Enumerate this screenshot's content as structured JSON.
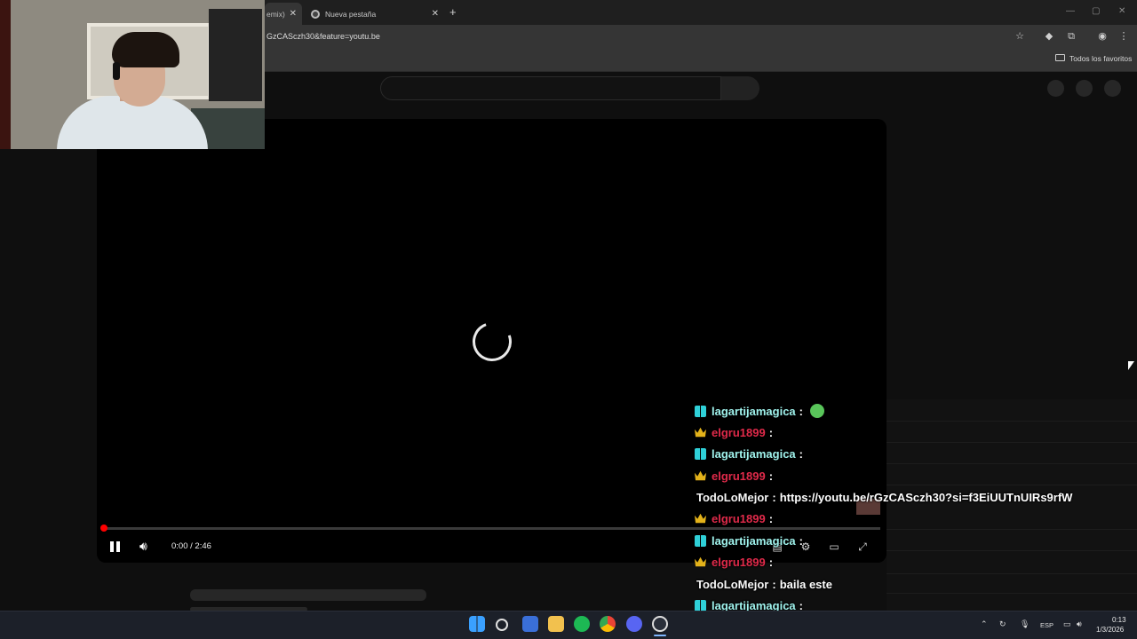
{
  "browser": {
    "active_tab_fragment": "emix)",
    "new_tab_label": "Nueva pestaña",
    "url_fragment": "GzCASczh30&feature=youtu.be",
    "bookmarks_folder_label": "Todos los favoritos",
    "icons": [
      "close-icon",
      "chrome-icon",
      "plus-icon",
      "star-icon",
      "extension-icon",
      "profile-icon",
      "kebab-menu-icon",
      "folder-icon"
    ]
  },
  "player": {
    "time": "0:00 / 2:46",
    "progress": 0.0,
    "state": "loading",
    "controls": [
      "pause-icon",
      "volume-icon",
      "subtitles-icon",
      "settings-icon",
      "theater-mode-icon",
      "fullscreen-icon"
    ]
  },
  "chat": {
    "messages": [
      {
        "user": "lagartijamagica",
        "badge": "mod",
        "color": "cyan",
        "text": ""
      },
      {
        "user": "elgru1899",
        "badge": "crown",
        "color": "red",
        "text": ""
      },
      {
        "user": "lagartijamagica",
        "badge": "mod",
        "color": "cyan",
        "text": ""
      },
      {
        "user": "elgru1899",
        "badge": "crown",
        "color": "red",
        "text": ""
      },
      {
        "user": "TodoLoMejor",
        "badge": "",
        "color": "white",
        "text": "https://youtu.be/rGzCASczh30?si=f3EiUUTnUIRs9rfW"
      },
      {
        "user": "elgru1899",
        "badge": "crown",
        "color": "red",
        "text": ""
      },
      {
        "user": "lagartijamagica",
        "badge": "mod",
        "color": "cyan",
        "text": ""
      },
      {
        "user": "elgru1899",
        "badge": "crown",
        "color": "red",
        "text": ""
      },
      {
        "user": "TodoLoMejor",
        "badge": "",
        "color": "white",
        "text": "baila este"
      },
      {
        "user": "lagartijamagica",
        "badge": "mod",
        "color": "cyan",
        "text": ""
      },
      {
        "user": "lagartijamagica",
        "badge": "mod",
        "color": "cyan",
        "text": ""
      }
    ],
    "separator": ":",
    "colors": {
      "cyan": "#9ff2ec",
      "red": "#e02a4a",
      "white": "#f5f5f5"
    }
  },
  "taskbar": {
    "apps": [
      "windows-start-icon",
      "search-icon",
      "store-icon",
      "file-explorer-icon",
      "spotify-icon",
      "chrome-icon",
      "discord-icon",
      "obs-icon"
    ],
    "language": "ESP",
    "clock_time": "0:13",
    "clock_date": "1/3/2026"
  },
  "colors": {
    "accent_red": "#ff0000",
    "background": "#0f0f0f"
  }
}
